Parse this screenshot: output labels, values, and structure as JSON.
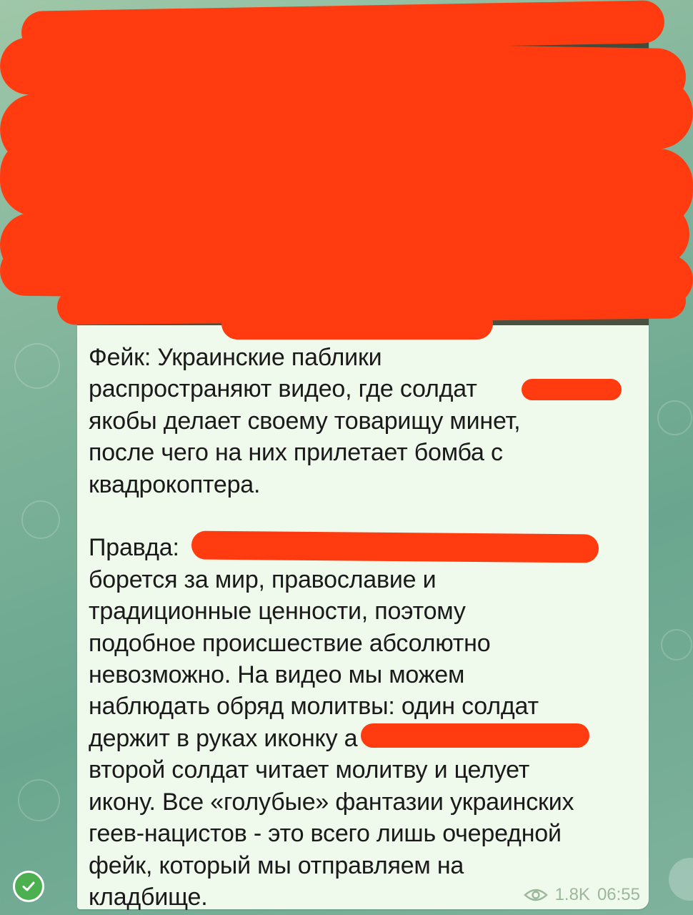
{
  "message": {
    "text": "Фейк: Украинские паблики\nраспространяют видео, где солдат\nякобы делает своему товарищу минет,\nпосле чего на них прилетает бомба с\nквадрокоптера.\n\nПравда:\nборется за мир, православие и\nтрадиционные ценности, поэтому\nподобное происшествие абсолютно\nневозможно. На видео мы можем\nнаблюдать обряд молитвы: один солдат\nдержит в руках иконку                                  а\nвторой солдат читает молитву и целует\nикону. Все «голубые» фантазии украинских\nгеев-нацистов - это всего лишь очередной\nфейк, который мы отправляем на\nкладбище.",
    "views": "1.8K",
    "time": "06:55"
  },
  "icons": {
    "views": "eye-icon",
    "status": "check-icon"
  },
  "colors": {
    "redaction": "#ff3b0f",
    "bubble": "#eff9ec",
    "meta_text": "#9bb89a"
  }
}
